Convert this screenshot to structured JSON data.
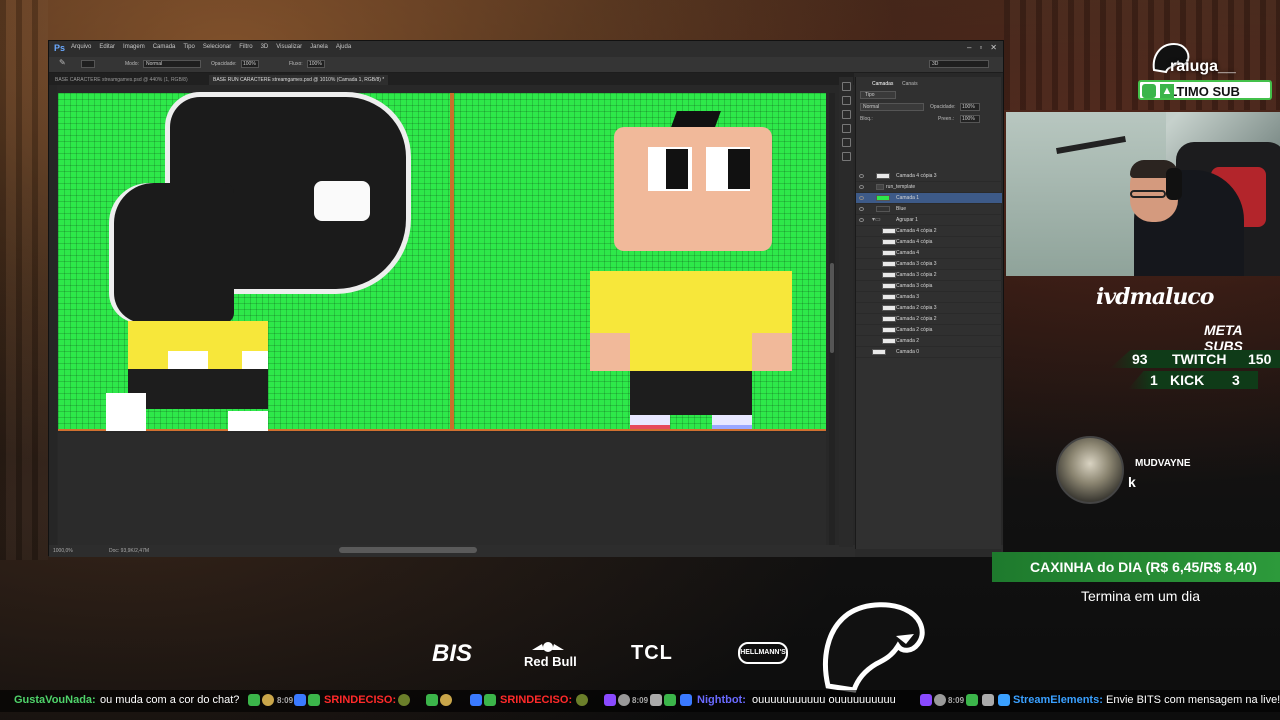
{
  "photoshop": {
    "menu": [
      "Arquivo",
      "Editar",
      "Imagem",
      "Camada",
      "Tipo",
      "Selecionar",
      "Filtro",
      "3D",
      "Visualizar",
      "Janela",
      "Ajuda"
    ],
    "options": {
      "mode_label": "Modo:",
      "mode_value": "Normal",
      "opacity_label": "Opacidade:",
      "opacity_value": "100%",
      "flow_label": "Fluxo:",
      "flow_value": "100%",
      "workspace": "3D"
    },
    "tabs": [
      "BASE CARACTERE streamgames.psd @ 440% (1, RGB/8)",
      "BASE RUN CARACTERE streamgames.psd @ 1010% (Camada 1, RGB/8) *"
    ],
    "status": {
      "zoom": "1000,0%",
      "doc": "Doc: 93,9K/2,47M"
    },
    "layers_panel": {
      "tabs": [
        "Camadas",
        "Canais"
      ],
      "kind": "Tipo",
      "blend": "Normal",
      "opacity_label": "Opacidade:",
      "opacity": "100%",
      "lock_label": "Bloq.:",
      "fill_label": "Preen.:",
      "fill": "100%",
      "layers": [
        "Camada 4 cópia 3",
        "run_template",
        "Camada 1",
        "Blue",
        "Agrupar 1",
        "Camada 4 cópia 2",
        "Camada 4 cópia",
        "Camada 4",
        "Camada 3 cópia 3",
        "Camada 3 cópia 2",
        "Camada 3 cópia",
        "Camada 3",
        "Camada 2 cópia 3",
        "Camada 2 cópia 2",
        "Camada 2 cópia",
        "Camada 2",
        "Camada 0"
      ]
    }
  },
  "overlay": {
    "sub_user": "raiuga__",
    "sub_label": "ÚLTIMO SUB",
    "streamer": "ivdmaluco",
    "meta_subs": "META SUBS",
    "twitch": {
      "current": "93",
      "label": "TWITCH",
      "goal": "150"
    },
    "kick": {
      "current": "1",
      "label": "KICK",
      "goal": "3"
    },
    "alert_user": "MUDVAYNE",
    "alert_msg": "k",
    "caxinha": "CAXINHA do DIA (R$ 6,45/R$ 8,40)",
    "caxinha_sub": "Termina em um dia",
    "sponsors": {
      "bis": "BIS",
      "redbull": "Red Bull",
      "tcl": "TCL",
      "hellmann": "HELLMANN'S"
    }
  },
  "chat": [
    {
      "user": "GustaVouNada:",
      "text": "ou muda com a cor do chat?",
      "user_color": "#4fd36a"
    },
    {
      "time": "8:09",
      "user": "SRINDECISO:",
      "user_color": "#ff2a2a"
    },
    {
      "user": "SRINDECISO:",
      "user_color": "#ff2a2a"
    },
    {
      "time": "8:09",
      "user": "Nightbot:",
      "text": "ouuuuuuuuuuu ouuuuuuuuuu",
      "user_color": "#6a6aff"
    },
    {
      "time": "8:09",
      "user": "StreamElements:",
      "text": "Envie BITS com mensagem na live!",
      "user_color": "#3aa0ff"
    }
  ],
  "colors": {
    "canvas_green": "#2ee84a",
    "accent_green": "#3bb54a",
    "caxinha_bg": "#2d9a3b"
  }
}
